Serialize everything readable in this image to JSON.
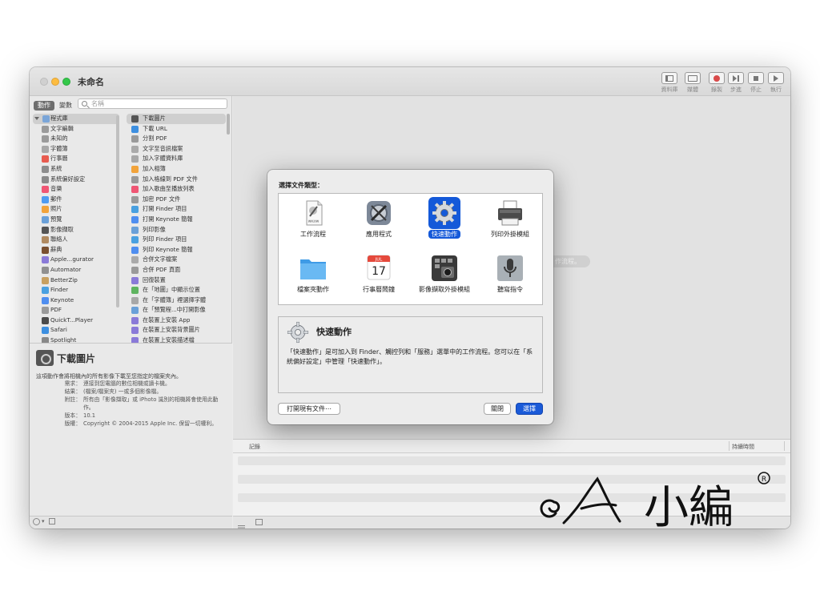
{
  "window": {
    "title": "未命名",
    "toolbar": {
      "library": "資料庫",
      "media": "媒體",
      "record": "錄製",
      "step": "步進",
      "stop": "停止",
      "run": "執行"
    }
  },
  "sidebar": {
    "tab_actions": "動作",
    "tab_variables": "變數",
    "search_placeholder": "名稱",
    "categories": [
      {
        "label": "程式庫",
        "color": "#7aa5d8"
      },
      {
        "label": "文字編輯",
        "color": "#9a9a9a"
      },
      {
        "label": "未知的",
        "color": "#9a9a9a"
      },
      {
        "label": "字體簿",
        "color": "#a8a8a8"
      },
      {
        "label": "行事曆",
        "color": "#e85b4f"
      },
      {
        "label": "系統",
        "color": "#8d8d8d"
      },
      {
        "label": "系統偏好設定",
        "color": "#8a8a8a"
      },
      {
        "label": "音樂",
        "color": "#f05674"
      },
      {
        "label": "郵件",
        "color": "#4f9bf0"
      },
      {
        "label": "照片",
        "color": "#f2a33a"
      },
      {
        "label": "預覽",
        "color": "#6aa0d8"
      },
      {
        "label": "影像擷取",
        "color": "#555555"
      },
      {
        "label": "聯絡人",
        "color": "#b08a60"
      },
      {
        "label": "辭典",
        "color": "#7a5030"
      },
      {
        "label": "Apple...gurator",
        "color": "#8a7ad8"
      },
      {
        "label": "Automator",
        "color": "#909090"
      },
      {
        "label": "BetterZip",
        "color": "#c8a060"
      },
      {
        "label": "Finder",
        "color": "#4aa0e0"
      },
      {
        "label": "Keynote",
        "color": "#4f8ef0"
      },
      {
        "label": "PDF",
        "color": "#9a9a9a"
      },
      {
        "label": "QuickT...Player",
        "color": "#4b4b4b"
      },
      {
        "label": "Safari",
        "color": "#3d8fe0"
      },
      {
        "label": "Spotlight",
        "color": "#888888"
      }
    ],
    "actions": [
      {
        "label": "下載圖片",
        "color": "#555555"
      },
      {
        "label": "下載 URL",
        "color": "#3d8fe0"
      },
      {
        "label": "分割 PDF",
        "color": "#9a9a9a"
      },
      {
        "label": "文字至音訊檔案",
        "color": "#aaaaaa"
      },
      {
        "label": "加入字體資料庫",
        "color": "#a8a8a8"
      },
      {
        "label": "加入相簿",
        "color": "#f2a33a"
      },
      {
        "label": "加入格線到 PDF 文件",
        "color": "#9a9a9a"
      },
      {
        "label": "加入歌曲至播放列表",
        "color": "#f05674"
      },
      {
        "label": "加密 PDF 文件",
        "color": "#9a9a9a"
      },
      {
        "label": "打開 Finder 項目",
        "color": "#4aa0e0"
      },
      {
        "label": "打開 Keynote 簡報",
        "color": "#4f8ef0"
      },
      {
        "label": "列印影像",
        "color": "#6aa0d8"
      },
      {
        "label": "列印 Finder 項目",
        "color": "#4aa0e0"
      },
      {
        "label": "列印 Keynote 簡報",
        "color": "#4f8ef0"
      },
      {
        "label": "合併文字檔案",
        "color": "#aaaaaa"
      },
      {
        "label": "合併 PDF 頁面",
        "color": "#9a9a9a"
      },
      {
        "label": "回復裝置",
        "color": "#8a7ad8"
      },
      {
        "label": "在「地圖」中顯示位置",
        "color": "#5fb460"
      },
      {
        "label": "在「字體簿」裡選擇字體",
        "color": "#a8a8a8"
      },
      {
        "label": "在「預覽程...中打開影像",
        "color": "#6aa0d8"
      },
      {
        "label": "在裝置上安裝 App",
        "color": "#8a7ad8"
      },
      {
        "label": "在裝置上安裝背景圖片",
        "color": "#8a7ad8"
      },
      {
        "label": "在裝置上安裝描述檔",
        "color": "#8a7ad8"
      }
    ],
    "description": {
      "title": "下載圖片",
      "summary": "這項動作會將相機內的所有影像下載至您指定的檔案夾內。",
      "rows": [
        {
          "key": "需求：",
          "value": "連接到您電腦的數位相機或讀卡機。"
        },
        {
          "key": "結果：",
          "value": "(檔案/檔案夾) 一或多個影像檔。"
        },
        {
          "key": "附註：",
          "value": "所有由「影像擷取」或 iPhoto 識別的相機將會使用此動作。"
        },
        {
          "key": "版本：",
          "value": "10.1"
        },
        {
          "key": "版權：",
          "value": "Copyright © 2004-2015 Apple Inc. 保留一切權利。"
        }
      ]
    }
  },
  "workflow": {
    "hint": "作流程。",
    "log_header": "記錄",
    "duration_header": "持續時間"
  },
  "sheet": {
    "title": "選擇文件類型：",
    "types": [
      {
        "label": "工作流程",
        "icon": "workflow-icon"
      },
      {
        "label": "應用程式",
        "icon": "application-icon"
      },
      {
        "label": "快速動作",
        "icon": "gear-icon",
        "selected": true
      },
      {
        "label": "列印外掛模組",
        "icon": "printer-icon"
      },
      {
        "label": "檔案夾動作",
        "icon": "folder-icon"
      },
      {
        "label": "行事曆鬧鐘",
        "icon": "calendar-icon",
        "cal_month": "JUL",
        "cal_day": "17"
      },
      {
        "label": "影像擷取外掛模組",
        "icon": "image-capture-icon"
      },
      {
        "label": "聽寫指令",
        "icon": "microphone-icon"
      }
    ],
    "detail": {
      "title": "快速動作",
      "text": "「快速動作」是可加入到 Finder、觸控列和「服務」選單中的工作流程。您可以在「系統偏好設定」中管理「快速動作」。"
    },
    "open_existing": "打開現有文件⋯",
    "close": "關閉",
    "choose": "選擇"
  },
  "watermark": {
    "text": "小編",
    "mark": "R"
  },
  "colors": {
    "accent": "#1a5ad8",
    "selection": "#1459d9"
  }
}
